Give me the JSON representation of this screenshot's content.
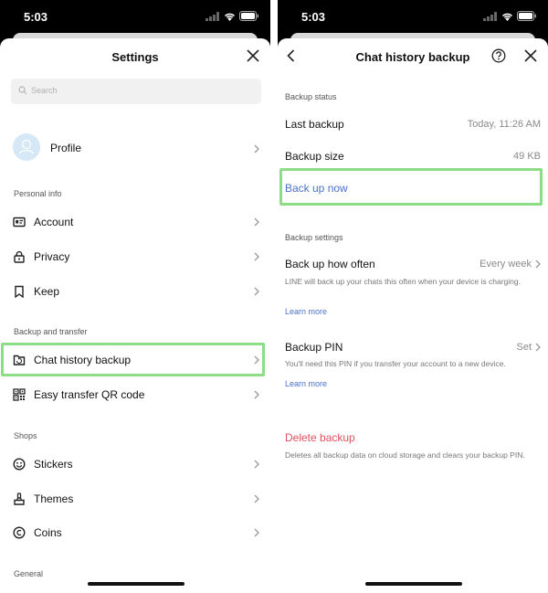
{
  "status": {
    "time": "5:03"
  },
  "left": {
    "title": "Settings",
    "search_placeholder": "Search",
    "profile_label": "Profile",
    "sections": {
      "personal": "Personal info",
      "backup": "Backup and transfer",
      "shops": "Shops",
      "general": "General"
    },
    "items": {
      "account": "Account",
      "privacy": "Privacy",
      "keep": "Keep",
      "chat_backup": "Chat history backup",
      "qr": "Easy transfer QR code",
      "stickers": "Stickers",
      "themes": "Themes",
      "coins": "Coins"
    }
  },
  "right": {
    "title": "Chat history backup",
    "backup_status": "Backup status",
    "last_backup_label": "Last backup",
    "last_backup_value": "Today, 11:26 AM",
    "backup_size_label": "Backup size",
    "backup_size_value": "49 KB",
    "backup_now": "Back up now",
    "backup_settings": "Backup settings",
    "how_often_label": "Back up how often",
    "how_often_value": "Every week",
    "how_often_desc": "LINE will back up your chats this often when your device is charging.",
    "learn_more_1": "Learn more",
    "pin_label": "Backup PIN",
    "pin_value": "Set",
    "pin_desc": "You'll need this PIN if you transfer your account to a new device.",
    "learn_more_2": "Learn more",
    "delete_label": "Delete backup",
    "delete_desc": "Deletes all backup data on cloud storage and clears your backup PIN."
  }
}
